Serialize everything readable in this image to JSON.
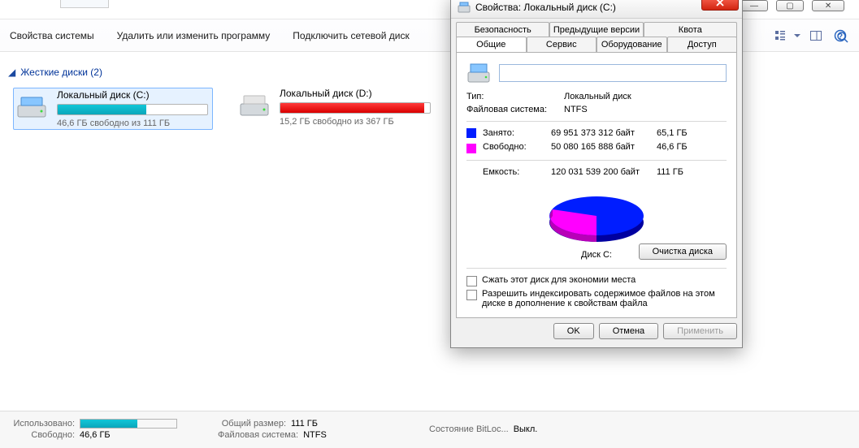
{
  "cmdbar": {
    "system_props": "Свойства системы",
    "uninstall": "Удалить или изменить программу",
    "map_drive": "Подключить сетевой диск"
  },
  "group_header": "Жесткие диски (2)",
  "drives": [
    {
      "name": "Локальный диск (C:)",
      "free_text": "46,6 ГБ свободно из 111 ГБ",
      "fill_pct": 59,
      "critical": false,
      "selected": true
    },
    {
      "name": "Локальный диск (D:)",
      "free_text": "15,2 ГБ свободно из 367 ГБ",
      "fill_pct": 96,
      "critical": true,
      "selected": false
    }
  ],
  "status": {
    "used_label": "Использовано:",
    "free_label": "Свободно:",
    "free_value": "46,6 ГБ",
    "total_label": "Общий размер:",
    "total_value": "111 ГБ",
    "fs_label": "Файловая система:",
    "fs_value": "NTFS",
    "bitlocker_label": "Состояние BitLoc...",
    "bitlocker_value": "Выкл."
  },
  "dialog": {
    "title": "Свойства: Локальный диск (C:)",
    "tabs_row1": [
      "Безопасность",
      "Предыдущие версии",
      "Квота"
    ],
    "tabs_row2": [
      "Общие",
      "Сервис",
      "Оборудование",
      "Доступ"
    ],
    "active_tab": "Общие",
    "type_label": "Тип:",
    "type_value": "Локальный диск",
    "fs_label": "Файловая система:",
    "fs_value": "NTFS",
    "used_label": "Занято:",
    "used_bytes": "69 951 373 312 байт",
    "used_gb": "65,1 ГБ",
    "free_label": "Свободно:",
    "free_bytes": "50 080 165 888 байт",
    "free_gb": "46,6 ГБ",
    "cap_label": "Емкость:",
    "cap_bytes": "120 031 539 200 байт",
    "cap_gb": "111 ГБ",
    "disk_label": "Диск C:",
    "cleanup": "Очистка диска",
    "compress": "Сжать этот диск для экономии места",
    "index": "Разрешить индексировать содержимое файлов на этом диске в дополнение к свойствам файла",
    "ok": "OK",
    "cancel": "Отмена",
    "apply": "Применить"
  },
  "chart_data": {
    "type": "pie",
    "title": "Диск C:",
    "series": [
      {
        "name": "Занято",
        "value": 69951373312,
        "value_gb": 65.1,
        "color": "#001dff"
      },
      {
        "name": "Свободно",
        "value": 50080165888,
        "value_gb": 46.6,
        "color": "#ff00ff"
      }
    ],
    "total": 120031539200,
    "total_gb": 111
  }
}
